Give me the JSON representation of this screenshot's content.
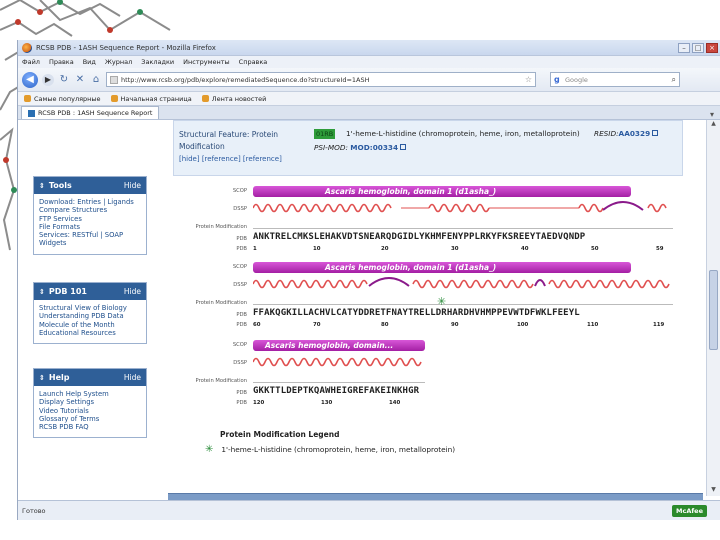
{
  "browser": {
    "title": "RCSB PDB - 1ASH Sequence Report - Mozilla Firefox",
    "menu": [
      "Файл",
      "Правка",
      "Вид",
      "Журнал",
      "Закладки",
      "Инструменты",
      "Справка"
    ],
    "url": "http://www.rcsb.org/pdb/explore/remediatedSequence.do?structureId=1ASH",
    "search_placeholder": "Google",
    "bookmarks": [
      "Самые популярные",
      "Начальная страница",
      "Лента новостей"
    ],
    "tab_label": "RCSB PDB : 1ASH Sequence Report",
    "status": "Готово",
    "mcafee": "McAfee"
  },
  "sidebar": {
    "tools": {
      "title": "Tools",
      "hide": "Hide",
      "items": [
        "Download: Entries | Ligands",
        "Compare Structures",
        "FTP Services",
        "File Formats",
        "Services: RESTful | SOAP",
        "Widgets"
      ]
    },
    "pdb101": {
      "title": "PDB 101",
      "hide": "Hide",
      "items": [
        "Structural View of Biology",
        "Understanding PDB Data",
        "Molecule of the Month",
        "Educational Resources"
      ]
    },
    "help": {
      "title": "Help",
      "hide": "Hide",
      "items": [
        "Launch Help System",
        "Display Settings",
        "Video Tutorials",
        "Glossary of Terms",
        "RCSB PDB FAQ"
      ]
    }
  },
  "feature": {
    "label_line1": "Structural Feature: Protein",
    "label_line2": "Modification",
    "links": "[hide] [reference] [reference]",
    "code": "01RB",
    "description": "1'-heme-L-histidine (chromoprotein, heme, iron, metalloprotein)",
    "resid_label": "RESID:",
    "resid_value": "AA0329",
    "psimod_label": "PSI-MOD:",
    "psimod_value": "MOD:00334"
  },
  "track_labels": {
    "scop": "SCOP",
    "dssp": "DSSP",
    "protmod": "Protein Modification",
    "pdb": "PDB"
  },
  "blocks": [
    {
      "scop_label": "Ascaris hemoglobin, domain 1 (d1asha_)",
      "seq": "ANKTRELCMKSLEHAKVDTSNEARQDGIDLYKHMFENYPPLRKYFKSREEYTAEDVQNDP",
      "ticks": [
        "1",
        "10",
        "20",
        "30",
        "40",
        "50",
        "59"
      ]
    },
    {
      "scop_label": "Ascaris hemoglobin, domain 1 (d1asha_)",
      "seq": "FFAKQGKILLACHVLCATYDDRETFNAYTRELLDRHARDHVHMPPEVWTDFWKLFEEYL",
      "ticks": [
        "60",
        "70",
        "80",
        "90",
        "100",
        "110",
        "119"
      ]
    },
    {
      "scop_label": "Ascaris hemoglobin, domain...",
      "seq": "GKKTTLDEPTKQAWHEIGREFAKEINKHGR",
      "ticks": [
        "120",
        "130",
        "140"
      ]
    }
  ],
  "legend": {
    "title": "Protein Modification Legend",
    "item": "1'-heme-L-histidine (chromoprotein, heme, iron, metalloprotein)"
  }
}
